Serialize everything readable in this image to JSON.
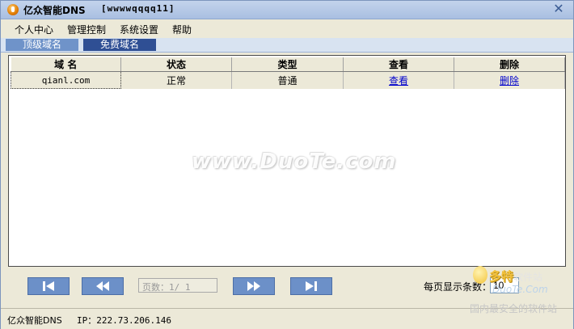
{
  "window": {
    "title": "亿众智能DNS",
    "user_tag": "[wwwwqqqq11]",
    "close_glyph": "✕"
  },
  "menu": [
    {
      "label": "个人中心"
    },
    {
      "label": "管理控制"
    },
    {
      "label": "系统设置"
    },
    {
      "label": "帮助"
    }
  ],
  "tabs": [
    {
      "label": "顶级域名",
      "active": true
    },
    {
      "label": "免费域名",
      "active": false
    }
  ],
  "table": {
    "columns": [
      "域 名",
      "状态",
      "类型",
      "查看",
      "删除"
    ],
    "rows": [
      {
        "domain": "qianl.com",
        "status": "正常",
        "type": "普通",
        "view": "查看",
        "delete": "删除"
      }
    ]
  },
  "pager": {
    "page_text": "页数：1/ 1",
    "per_page_label": "每页显示条数：",
    "per_page_value": "10",
    "buttons": [
      "first-page-icon",
      "prev-page-icon",
      "next-page-icon",
      "last-page-icon"
    ]
  },
  "statusbar": {
    "app": "亿众智能DNS",
    "ip": "IP：222.73.206.146"
  },
  "watermarks": {
    "center": "www.DuoTe.com",
    "logo_line1": "多特",
    "logo_line1_small": "软件站",
    "logo_line2": "DuoTe.Com",
    "logo_line3": "国内最安全的软件站"
  },
  "colors": {
    "titlebar": "#a9bfe1",
    "tab_active": "#6f93c9",
    "tab_inactive": "#2f4f94",
    "pager_button": "#6c90c8",
    "link": "#0000cc"
  }
}
